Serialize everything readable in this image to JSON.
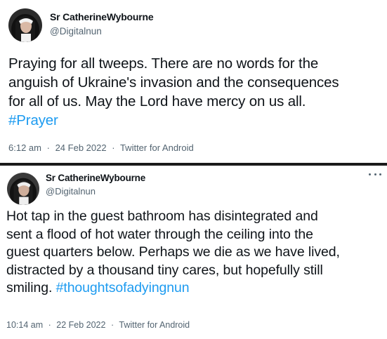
{
  "tweets": [
    {
      "author": {
        "display_name": "Sr CatherineWybourne",
        "handle": "@Digitalnun"
      },
      "text_lines": [
        "Praying for all tweeps. There are no words for the",
        "anguish of Ukraine's invasion and the consequences",
        "for all of us. May the Lord have mercy on us all."
      ],
      "hashtag": "#Prayer",
      "time": "6:12 am",
      "date": "24 Feb 2022",
      "source": "Twitter for Android",
      "separator": "·"
    },
    {
      "author": {
        "display_name": "Sr CatherineWybourne",
        "handle": "@Digitalnun"
      },
      "text_lines": [
        "Hot tap in the guest bathroom has disintegrated and",
        "sent a flood of hot water through the ceiling into the",
        "guest quarters below. Perhaps we die as we have lived,",
        "distracted by a thousand tiny cares, but hopefully still"
      ],
      "last_line_prefix": "smiling. ",
      "hashtag": "#thoughtsofadyingnun",
      "time": "10:14 am",
      "date": "22 Feb 2022",
      "source": "Twitter for Android",
      "separator": "·",
      "more_icon": "more-horizontal-icon"
    }
  ],
  "colors": {
    "text": "#0f1419",
    "secondary": "#536471",
    "hashtag": "#1d9bf0",
    "divider": "#1a1a1a"
  }
}
